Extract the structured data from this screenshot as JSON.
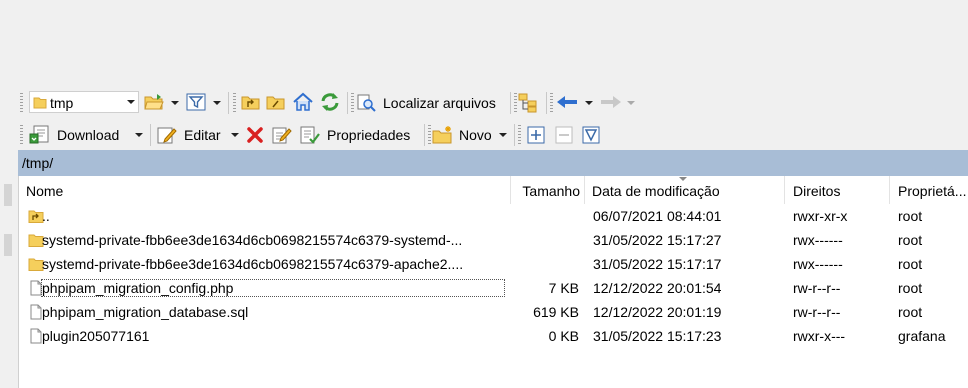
{
  "toolbar1": {
    "location_combo_value": "tmp",
    "find_label": "Localizar arquivos"
  },
  "toolbar2": {
    "download_label": "Download",
    "edit_label": "Editar",
    "properties_label": "Propriedades",
    "new_label": "Novo"
  },
  "path": "/tmp/",
  "columns": {
    "name": "Nome",
    "size": "Tamanho",
    "modified": "Data de modificação",
    "rights": "Direitos",
    "owner": "Proprietá..."
  },
  "rows": [
    {
      "name": "..",
      "size": "",
      "modified": "06/07/2021 08:44:01",
      "rights": "rwxr-xr-x",
      "owner": "root",
      "icon": "parent-folder-icon"
    },
    {
      "name": "systemd-private-fbb6ee3de1634d6cb0698215574c6379-systemd-...",
      "size": "",
      "modified": "31/05/2022 15:17:27",
      "rights": "rwx------",
      "owner": "root",
      "icon": "folder-icon"
    },
    {
      "name": "systemd-private-fbb6ee3de1634d6cb0698215574c6379-apache2....",
      "size": "",
      "modified": "31/05/2022 15:17:17",
      "rights": "rwx------",
      "owner": "root",
      "icon": "folder-icon"
    },
    {
      "name": "phpipam_migration_config.php",
      "size": "7 KB",
      "modified": "12/12/2022 20:01:54",
      "rights": "rw-r--r--",
      "owner": "root",
      "icon": "file-icon"
    },
    {
      "name": "phpipam_migration_database.sql",
      "size": "619 KB",
      "modified": "12/12/2022 20:01:19",
      "rights": "rw-r--r--",
      "owner": "root",
      "icon": "file-icon"
    },
    {
      "name": "plugin205077161",
      "size": "0 KB",
      "modified": "31/05/2022 15:17:23",
      "rights": "rwxr-x---",
      "owner": "grafana",
      "icon": "file-icon"
    }
  ],
  "colors": {
    "path_bar": "#a8bdd6",
    "folder": "#f5cf5c",
    "accent_blue": "#2f6fcf",
    "delete_red": "#d92020",
    "refresh_green": "#3a9a3a"
  }
}
